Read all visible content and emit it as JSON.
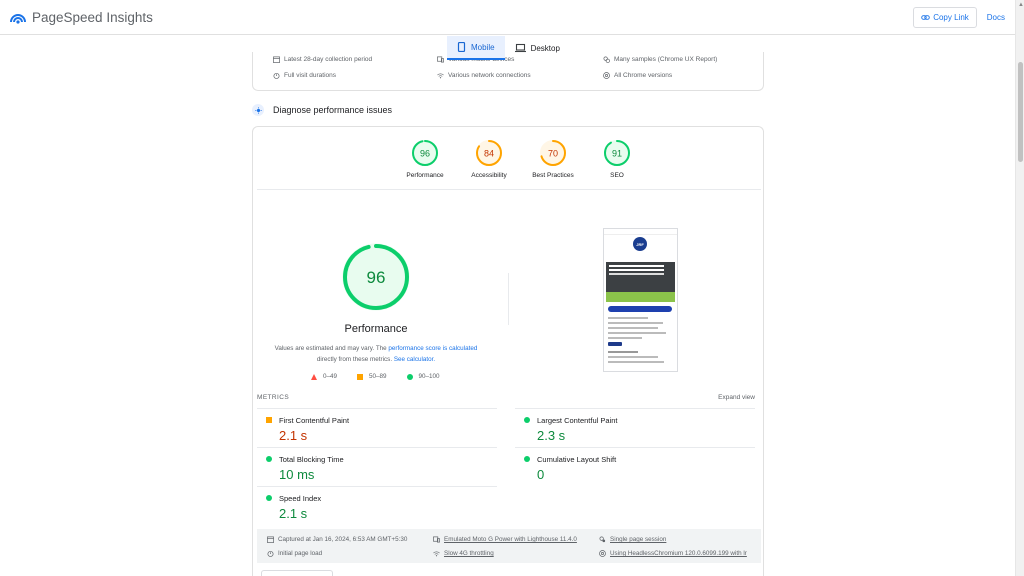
{
  "header": {
    "app_title": "PageSpeed Insights",
    "copy_link_label": "Copy Link",
    "docs_label": "Docs",
    "brand_color": "#1a73e8"
  },
  "device_tabs": [
    {
      "label": "Mobile",
      "active": true
    },
    {
      "label": "Desktop",
      "active": false
    }
  ],
  "crux_info": {
    "row1": [
      {
        "icon": "calendar-icon",
        "text": "Latest 28-day collection period"
      },
      {
        "icon": "devices-icon",
        "text": "Various mobile devices"
      },
      {
        "icon": "samples-icon",
        "text": "Many samples (Chrome UX Report)"
      }
    ],
    "row2": [
      {
        "icon": "timer-icon",
        "text": "Full visit durations"
      },
      {
        "icon": "wifi-icon",
        "text": "Various network connections"
      },
      {
        "icon": "chrome-icon",
        "text": "All Chrome versions"
      }
    ]
  },
  "diagnose": {
    "title": "Diagnose performance issues"
  },
  "categories": [
    {
      "label": "Performance",
      "score": "96",
      "status": "good"
    },
    {
      "label": "Accessibility",
      "score": "84",
      "status": "average"
    },
    {
      "label": "Best Practices",
      "score": "70",
      "status": "average"
    },
    {
      "label": "SEO",
      "score": "91",
      "status": "good"
    }
  ],
  "performance": {
    "score": "96",
    "score_fraction": 0.96,
    "title": "Performance",
    "note_prefix": "Values are estimated and may vary. The ",
    "note_link1": "performance score is calculated",
    "note_middle": " directly from these metrics. ",
    "note_link2": "See calculator."
  },
  "legend": [
    {
      "shape": "triangle",
      "range": "0–49",
      "color": "#ff4e42"
    },
    {
      "shape": "square",
      "range": "50–89",
      "color": "#ffa400"
    },
    {
      "shape": "circle",
      "range": "90–100",
      "color": "#0cce6b"
    }
  ],
  "screenshot": {
    "logo_text": "JRF"
  },
  "metrics": {
    "section_label": "METRICS",
    "expand_label": "Expand view",
    "items": [
      {
        "name": "First Contentful Paint",
        "value": "2.1 s",
        "status": "orange"
      },
      {
        "name": "Largest Contentful Paint",
        "value": "2.3 s",
        "status": "green"
      },
      {
        "name": "Total Blocking Time",
        "value": "10 ms",
        "status": "green"
      },
      {
        "name": "Cumulative Layout Shift",
        "value": "0",
        "status": "green"
      },
      {
        "name": "Speed Index",
        "value": "2.1 s",
        "status": "green"
      }
    ]
  },
  "run_info": {
    "captured": "Captured at Jan 16, 2024, 6:53 AM GMT+5:30",
    "load": "Initial page load",
    "device": "Emulated Moto G Power with Lighthouse 11.4.0",
    "throttling": "Slow 4G throttling",
    "session": "Single page session",
    "browser": "Using HeadlessChromium 120.0.6099.199 with lr"
  },
  "colors": {
    "good": "#0cce6b",
    "average": "#ffa400",
    "poor": "#ff4e42",
    "good_text": "#0d8a3d",
    "average_text": "#c33300"
  }
}
